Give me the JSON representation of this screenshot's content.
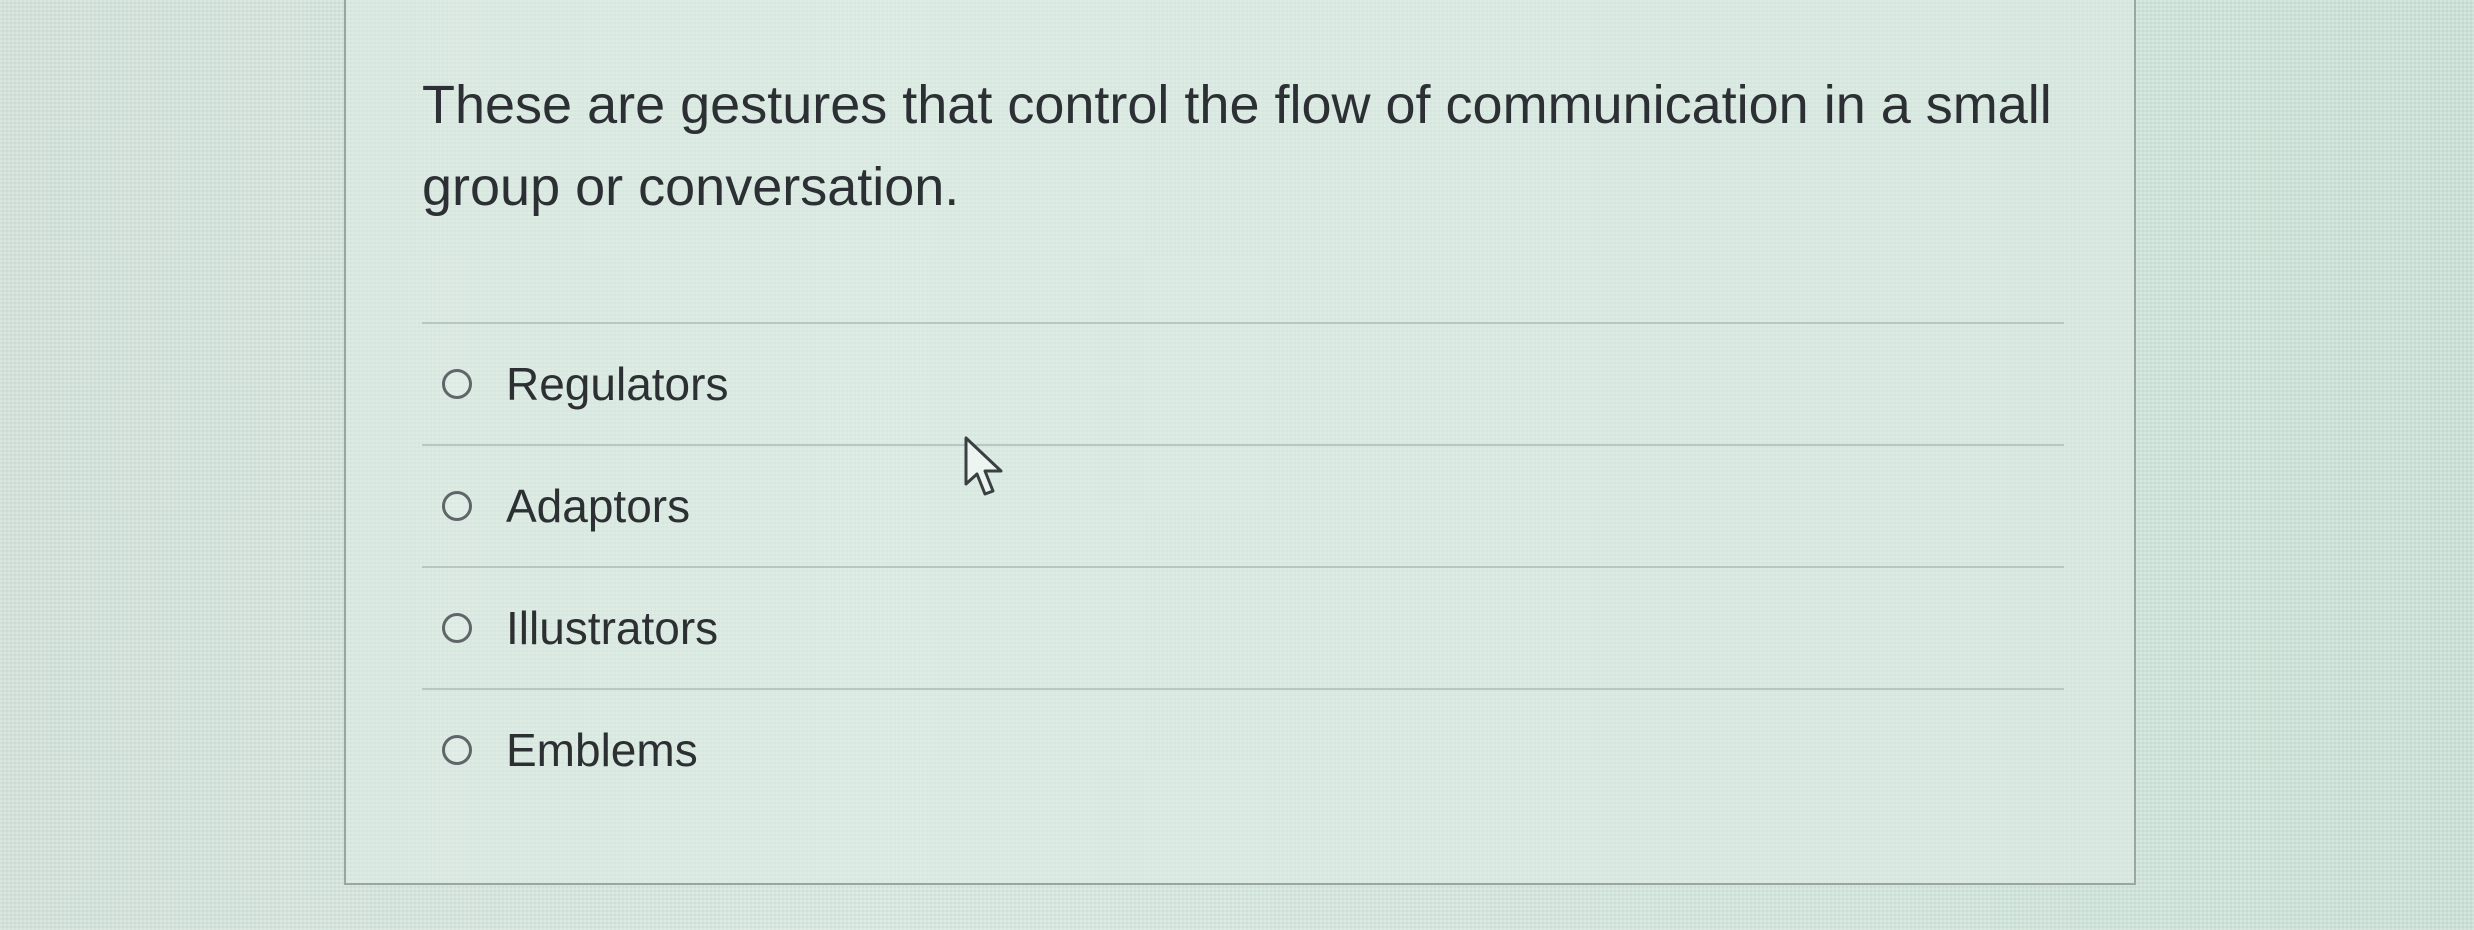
{
  "question": {
    "text": "These are gestures that control the flow of communication in a small group or conversation."
  },
  "answers": [
    {
      "label": "Regulators",
      "selected": false
    },
    {
      "label": "Adaptors",
      "selected": false
    },
    {
      "label": "Illustrators",
      "selected": false
    },
    {
      "label": "Emblems",
      "selected": false
    }
  ],
  "cursor": {
    "icon": "arrow-pointer-icon"
  }
}
